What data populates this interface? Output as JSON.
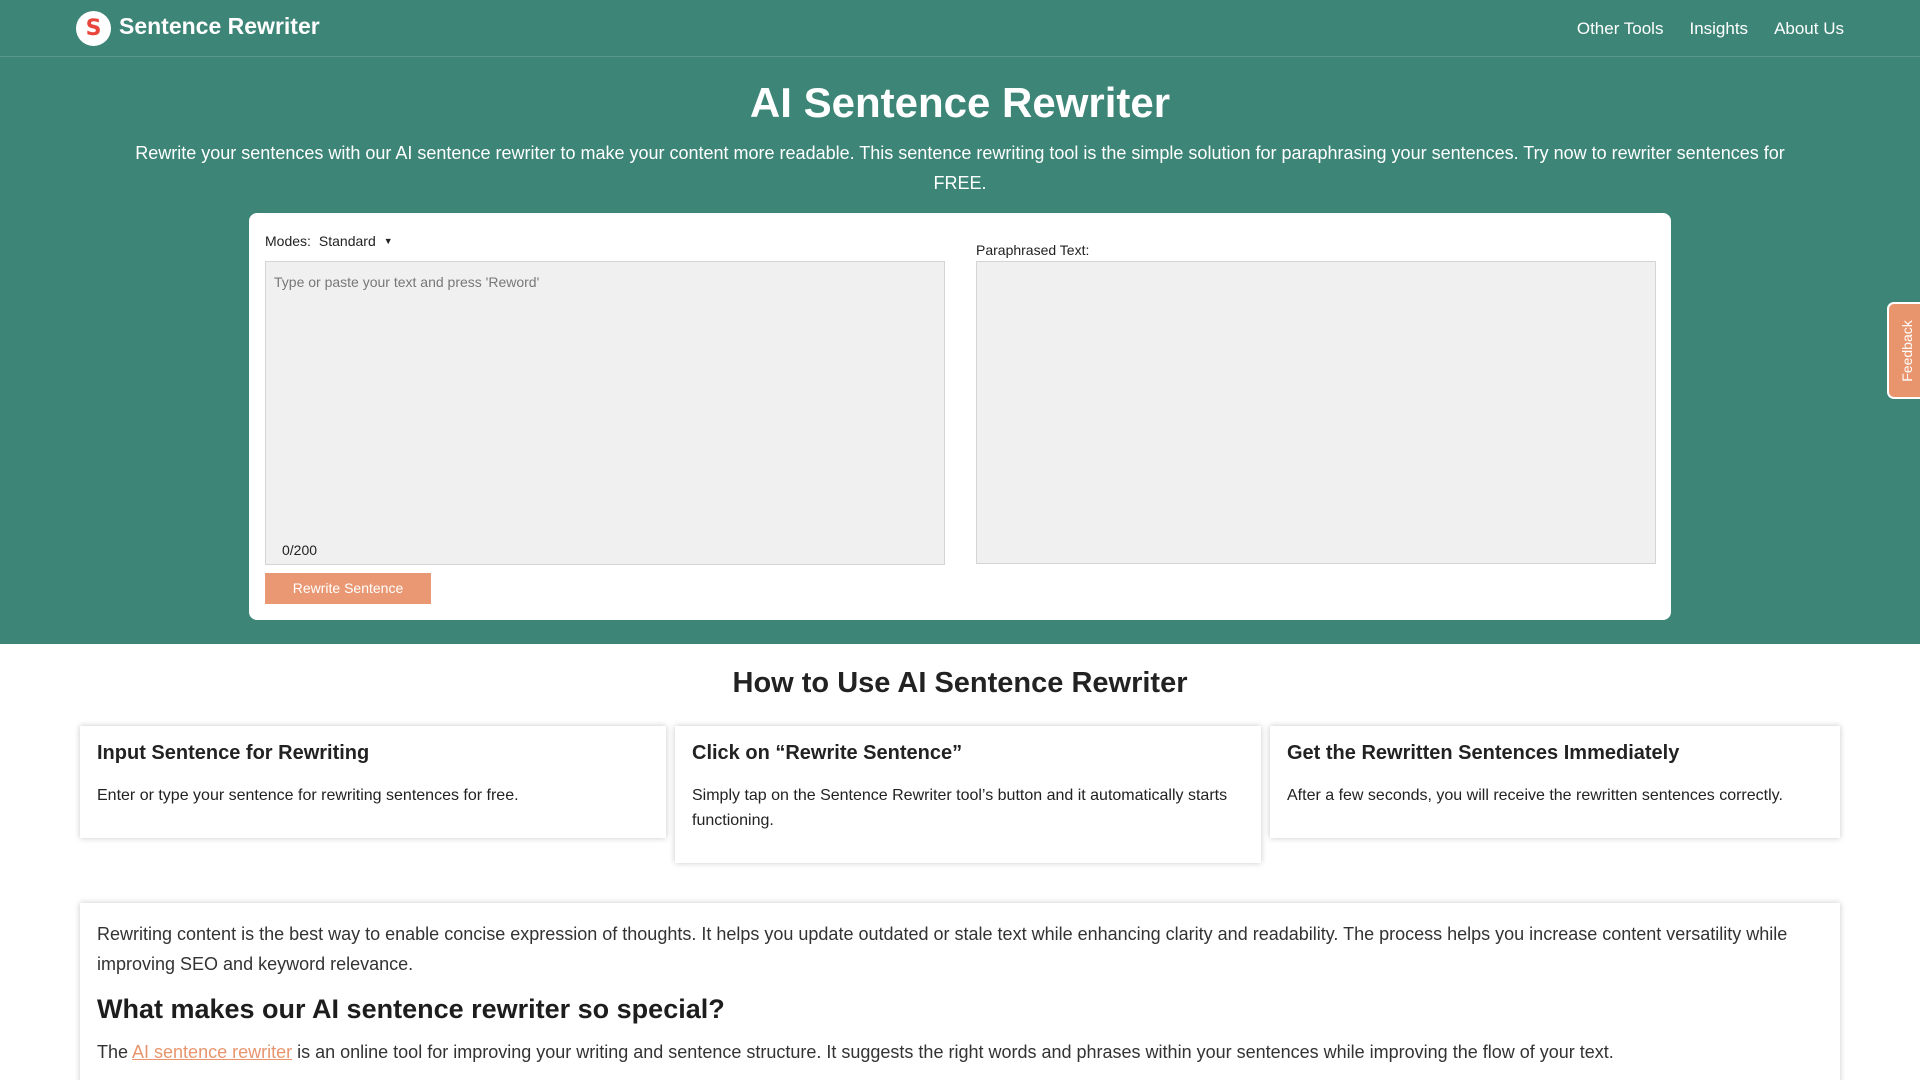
{
  "header": {
    "logo_letter": "S",
    "brand": "Sentence Rewriter",
    "nav": [
      "Other Tools",
      "Insights",
      "About Us"
    ]
  },
  "hero": {
    "title": "AI Sentence Rewriter",
    "description": "Rewrite your sentences with our AI sentence rewriter to make your content more readable. This sentence rewriting tool is the simple solution for paraphrasing your sentences. Try now to rewriter sentences for FREE."
  },
  "tool": {
    "modes_label": "Modes:",
    "mode_value": "Standard",
    "caret_icon": "caret-down-icon",
    "input_placeholder": "Type or paste your text and press 'Reword'",
    "char_count": "0/200",
    "output_label": "Paraphrased Text:",
    "button_label": "Rewrite Sentence"
  },
  "feedback_label": "Feedback",
  "howto": {
    "title": "How to Use AI Sentence Rewriter",
    "cards": [
      {
        "title": "Input Sentence for Rewriting",
        "text": "Enter or type your sentence for rewriting sentences for free."
      },
      {
        "title": "Click on “Rewrite Sentence”",
        "text": "Simply tap on the Sentence Rewriter tool’s button and it automatically starts functioning."
      },
      {
        "title": "Get the Rewritten Sentences Immediately",
        "text": "After a few seconds, you will receive the rewritten sentences correctly."
      }
    ]
  },
  "article": {
    "intro": "Rewriting content is the best way to enable concise expression of thoughts. It helps you update outdated or stale text while enhancing clarity and readability. The process helps you increase content versatility while improving SEO and keyword relevance.",
    "heading": "What makes our AI sentence rewriter so special?",
    "p2_prefix": "The ",
    "p2_link": "AI sentence rewriter",
    "p2_suffix": " is an online tool for improving your writing and sentence structure. It suggests the right words and phrases within your sentences while improving the flow of your text."
  },
  "colors": {
    "brand_green": "#3c8577",
    "accent_orange": "#e99873",
    "logo_red": "#e8463c"
  }
}
